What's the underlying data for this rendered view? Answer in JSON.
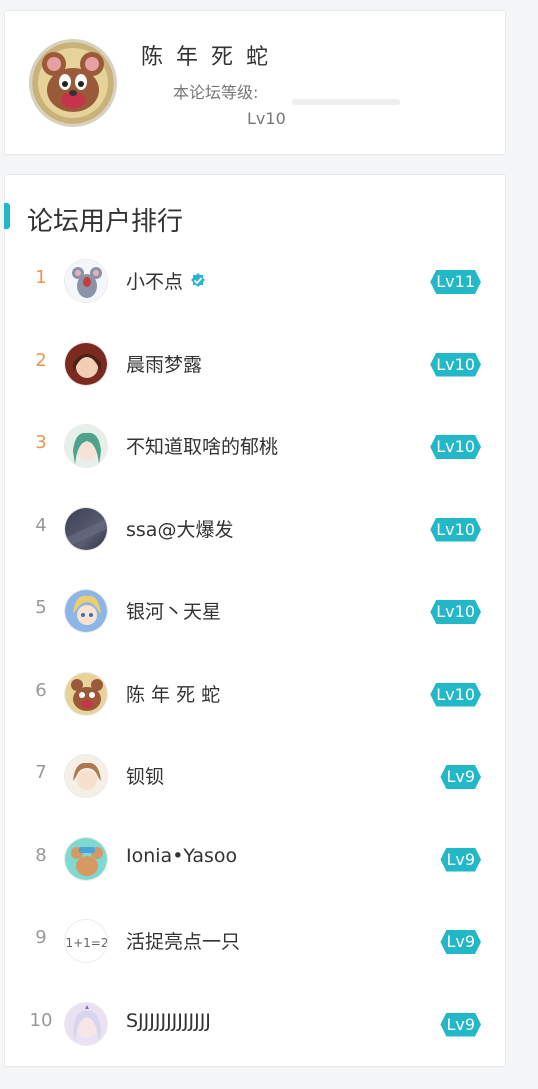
{
  "profile": {
    "name": "陈 年 死 蛇",
    "level_label": "本论坛等级:",
    "level_value": "Lv10",
    "level_progress": 0.0
  },
  "ranking": {
    "title": "论坛用户排行",
    "users": [
      {
        "rank": "1",
        "name": "小不点",
        "level": "Lv11",
        "verified": true,
        "avatar": "grey-mouse"
      },
      {
        "rank": "2",
        "name": "晨雨梦露",
        "level": "Lv10",
        "verified": false,
        "avatar": "anime-girl-red"
      },
      {
        "rank": "3",
        "name": "不知道取啥的郁桃",
        "level": "Lv10",
        "verified": false,
        "avatar": "anime-girl-green"
      },
      {
        "rank": "4",
        "name": "ssa@大爆发",
        "level": "Lv10",
        "verified": false,
        "avatar": "dark-gradient"
      },
      {
        "rank": "5",
        "name": "银河丶天星",
        "level": "Lv10",
        "verified": false,
        "avatar": "anime-girl-blonde"
      },
      {
        "rank": "6",
        "name": "陈 年 死 蛇",
        "level": "Lv10",
        "verified": false,
        "avatar": "cartoon-cat-jerry"
      },
      {
        "rank": "7",
        "name": "钡钡",
        "level": "Lv9",
        "verified": false,
        "avatar": "anime-girl-brown"
      },
      {
        "rank": "8",
        "name": "Ionia•Yasoo",
        "level": "Lv9",
        "verified": false,
        "avatar": "cartoon-mouse-cyan"
      },
      {
        "rank": "9",
        "name": "活捉亮点一只",
        "level": "Lv9",
        "verified": false,
        "avatar": "handwritten-math"
      },
      {
        "rank": "10",
        "name": "SJJJJJJJJJJJJJ",
        "level": "Lv9",
        "verified": false,
        "avatar": "anime-girl-white"
      }
    ]
  },
  "colors": {
    "accent": "#20b8c7",
    "badge": "#22b8c8",
    "top_rank": "#f0944a",
    "rank": "#999999"
  }
}
